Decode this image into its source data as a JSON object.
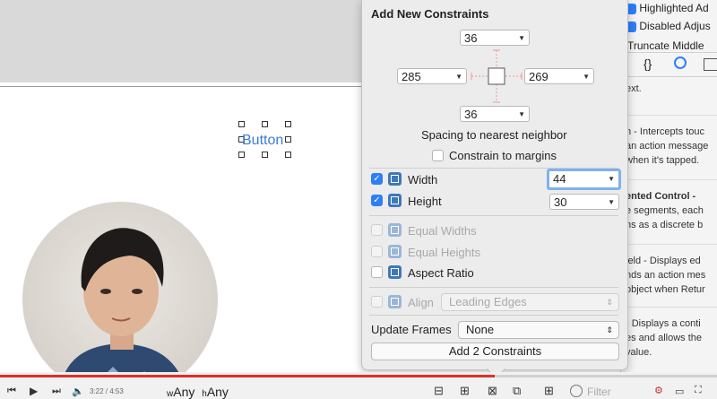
{
  "popover": {
    "title": "Add New Constraints",
    "spacing": {
      "top": "36",
      "left": "285",
      "right": "269",
      "bottom": "36"
    },
    "spacing_caption": "Spacing to nearest neighbor",
    "constrain_margins_label": "Constrain to margins",
    "width": {
      "label": "Width",
      "value": "44",
      "checked": true
    },
    "height": {
      "label": "Height",
      "value": "30",
      "checked": true
    },
    "equal_widths_label": "Equal Widths",
    "equal_heights_label": "Equal Heights",
    "aspect_ratio_label": "Aspect Ratio",
    "align_label": "Align",
    "align_value": "Leading Edges",
    "update_frames_label": "Update Frames",
    "update_frames_value": "None",
    "add_button_label": "Add 2 Constraints"
  },
  "canvas": {
    "button_label": "Button"
  },
  "inspector": {
    "highlighted_label": "Highlighted Ad",
    "disabled_label": "Disabled Adjus",
    "line_break_label": "Truncate Middle",
    "library_snippets": [
      "ext.",
      "n - Intercepts touc",
      "an action message",
      "when it's tapped.",
      "ented Control -",
      "e segments, each",
      "ns as a discrete b",
      "ield - Displays ed",
      "nds an action mes",
      "object when Retur",
      "- Displays a conti",
      "es and allows the",
      "value."
    ]
  },
  "bottom_bar": {
    "size_class_w_prefix": "w",
    "size_class_w": "Any",
    "size_class_h_prefix": "h",
    "size_class_h": "Any",
    "filter_placeholder": "Filter"
  },
  "video": {
    "time": "3:22 / 4:53",
    "progress": 0.69
  },
  "colors": {
    "accent": "#2d7ff9",
    "progress": "#e52d27"
  }
}
